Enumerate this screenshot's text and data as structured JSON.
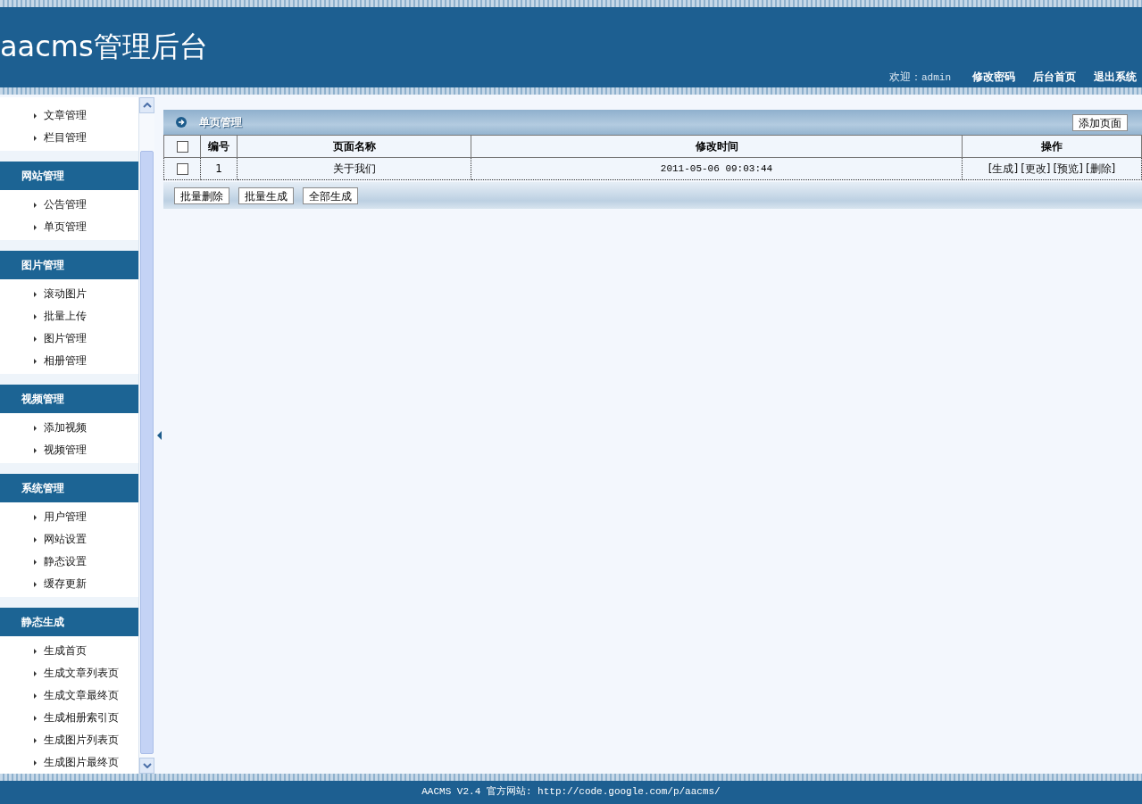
{
  "header": {
    "title": "aacms管理后台",
    "welcome_label": "欢迎：",
    "username": "admin",
    "links": [
      "修改密码",
      "后台首页",
      "退出系统"
    ]
  },
  "sidebar": {
    "groups": [
      {
        "items": [
          "文章管理",
          "栏目管理"
        ]
      },
      {
        "title": "网站管理",
        "items": [
          "公告管理",
          "单页管理"
        ]
      },
      {
        "title": "图片管理",
        "items": [
          "滚动图片",
          "批量上传",
          "图片管理",
          "相册管理"
        ]
      },
      {
        "title": "视频管理",
        "items": [
          "添加视频",
          "视频管理"
        ]
      },
      {
        "title": "系统管理",
        "items": [
          "用户管理",
          "网站设置",
          "静态设置",
          "缓存更新"
        ]
      },
      {
        "title": "静态生成",
        "items": [
          "生成首页",
          "生成文章列表页",
          "生成文章最终页",
          "生成相册索引页",
          "生成图片列表页",
          "生成图片最终页"
        ]
      }
    ]
  },
  "panel": {
    "title": "单页管理",
    "add_button": "添加页面",
    "table": {
      "header_checked": false,
      "columns": [
        "编号",
        "页面名称",
        "修改时间",
        "操作"
      ],
      "rows": [
        {
          "checked": false,
          "id": "1",
          "name": "关于我们",
          "modified": "2011-05-06 09:03:44",
          "actions": [
            "[生成]",
            "[更改]",
            "[预览]",
            "[删除]"
          ]
        }
      ]
    },
    "bottom_buttons": [
      "批量删除",
      "批量生成",
      "全部生成"
    ]
  },
  "footer": {
    "text": "AACMS V2.4 官方网站: http://code.google.com/p/aacms/"
  }
}
